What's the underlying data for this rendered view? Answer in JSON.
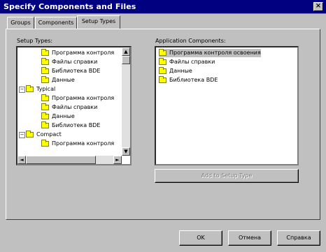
{
  "window": {
    "title": "Specify Components and Files",
    "close_glyph": "×"
  },
  "tabs": [
    {
      "label": "Groups",
      "active": false
    },
    {
      "label": "Components",
      "active": false
    },
    {
      "label": "Setup Types",
      "active": true
    }
  ],
  "setup_types": {
    "label": "Setup Types:",
    "rows": [
      {
        "label": "Программа контроля",
        "type": "folder"
      },
      {
        "label": "Файлы справки",
        "type": "folder"
      },
      {
        "label": "Библиотека BDE",
        "type": "folder"
      },
      {
        "label": "Данные",
        "type": "folder"
      },
      {
        "label": "Typical",
        "type": "group",
        "expander": "−"
      },
      {
        "label": "Программа контроля",
        "type": "folder"
      },
      {
        "label": "Файлы справки",
        "type": "folder"
      },
      {
        "label": "Данные",
        "type": "folder"
      },
      {
        "label": "Библиотека BDE",
        "type": "folder"
      },
      {
        "label": "Compact",
        "type": "group",
        "expander": "−"
      },
      {
        "label": "Программа контроля",
        "type": "folder"
      }
    ],
    "scroll_up": "▲",
    "scroll_down": "▼",
    "scroll_left": "◄",
    "scroll_right": "►"
  },
  "application_components": {
    "label": "Application Components:",
    "rows": [
      {
        "label": "Программа контроля освоения",
        "selected": true
      },
      {
        "label": "Файлы справки",
        "selected": false
      },
      {
        "label": "Данные",
        "selected": false
      },
      {
        "label": "Библиотека BDE",
        "selected": false
      }
    ],
    "add_button": "Add to Setup Type"
  },
  "footer": {
    "ok": "OK",
    "cancel": "Отмена",
    "help": "Справка"
  }
}
